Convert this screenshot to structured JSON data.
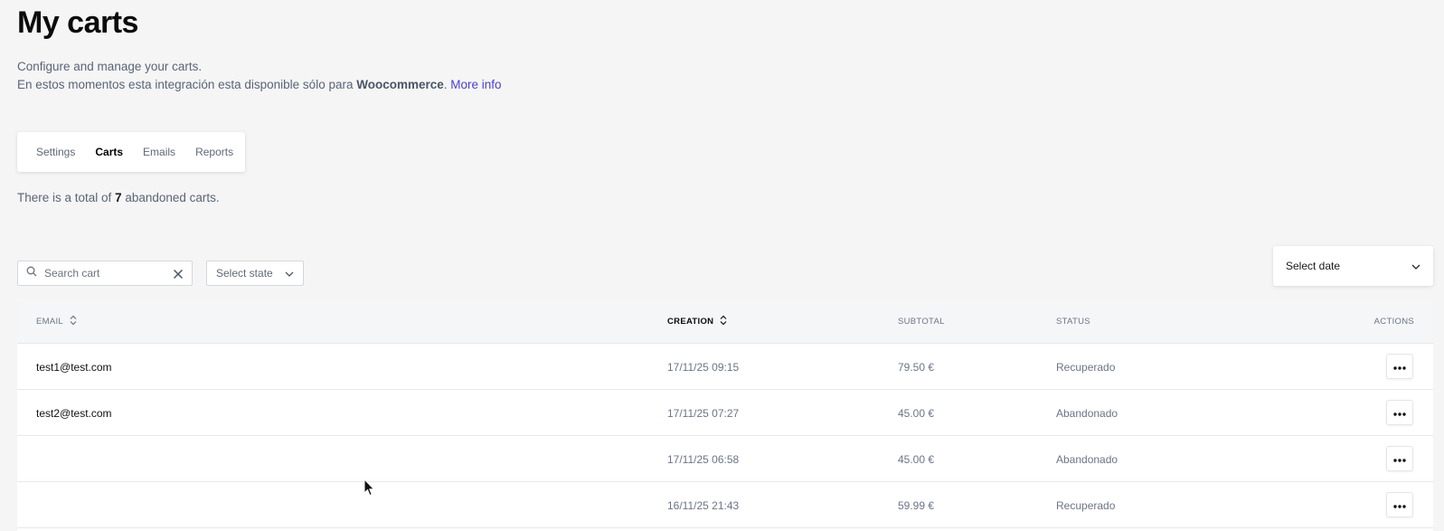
{
  "header": {
    "title": "My carts",
    "line1": "Configure and manage your carts.",
    "line2_prefix": "En estos momentos esta integración esta disponible sólo para ",
    "line2_bold": "Woocommerce",
    "line2_suffix": ". ",
    "more_info": "More info"
  },
  "tabs": [
    {
      "label": "Settings",
      "active": false
    },
    {
      "label": "Carts",
      "active": true
    },
    {
      "label": "Emails",
      "active": false
    },
    {
      "label": "Reports",
      "active": false
    }
  ],
  "summary": {
    "prefix": "There is a total of ",
    "count": "7",
    "suffix": " abandoned carts."
  },
  "filters": {
    "search_placeholder": "Search cart",
    "state_label": "Select state",
    "date_label": "Select date"
  },
  "table": {
    "headers": {
      "email": "EMAIL",
      "creation": "CREATION",
      "subtotal": "SUBTOTAL",
      "status": "STATUS",
      "actions": "ACTIONS"
    },
    "rows": [
      {
        "email": "test1@test.com",
        "creation": "17/11/25 09:15",
        "subtotal": "79.50 €",
        "status": "Recuperado"
      },
      {
        "email": "test2@test.com",
        "creation": "17/11/25 07:27",
        "subtotal": "45.00 €",
        "status": "Abandonado"
      },
      {
        "email": "",
        "creation": "17/11/25 06:58",
        "subtotal": "45.00 €",
        "status": "Abandonado"
      },
      {
        "email": "",
        "creation": "16/11/25 21:43",
        "subtotal": "59.99 €",
        "status": "Recuperado"
      }
    ]
  },
  "colors": {
    "background": "#f5f5f5",
    "link": "#4a3fd6",
    "muted_text": "#6b7487"
  }
}
